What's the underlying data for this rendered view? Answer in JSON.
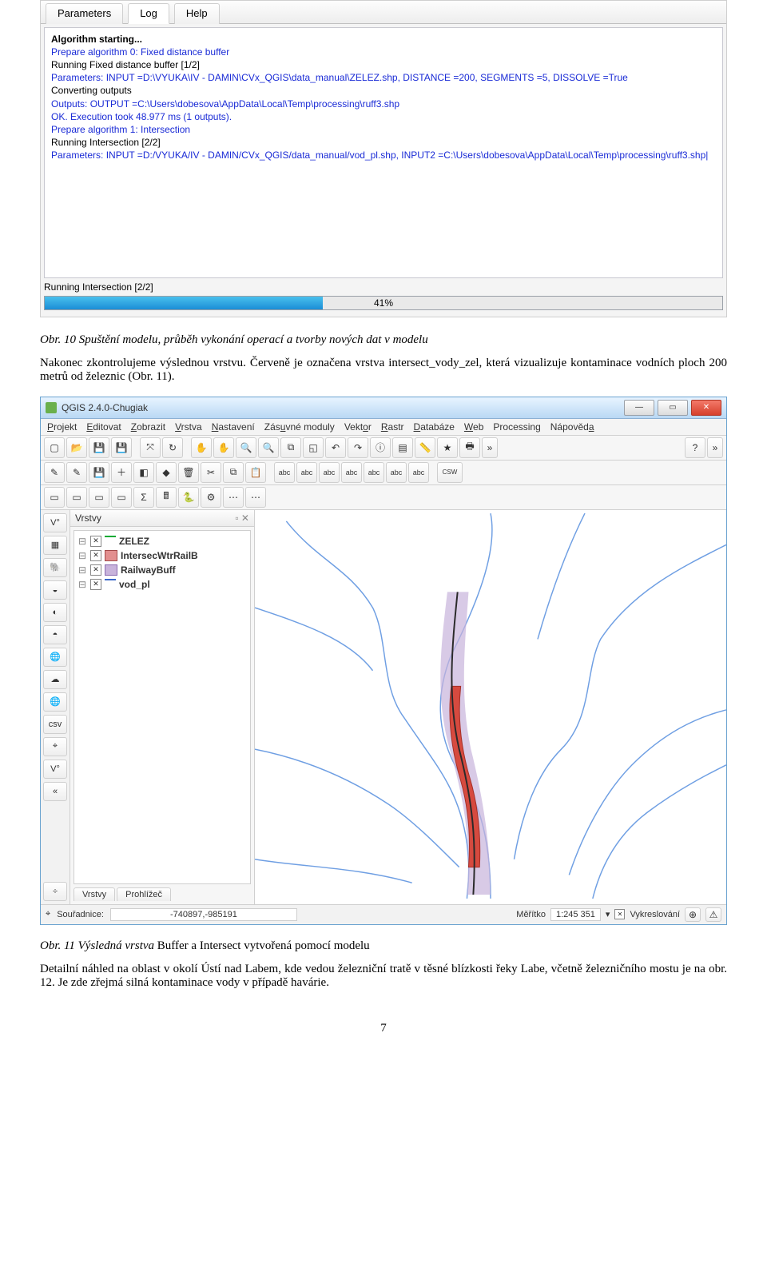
{
  "log_window": {
    "tabs": [
      "Parameters",
      "Log",
      "Help"
    ],
    "active_tab": 1,
    "lines": [
      {
        "cls": "bold",
        "text": "Algorithm starting..."
      },
      {
        "cls": "blue",
        "text": "Prepare algorithm 0: Fixed distance buffer"
      },
      {
        "cls": "black",
        "text": "Running Fixed distance buffer [1/2]"
      },
      {
        "cls": "blue",
        "text": "Parameters: INPUT =D:\\VYUKA\\IV - DAMIN\\CVx_QGIS\\data_manual\\ZELEZ.shp, DISTANCE =200, SEGMENTS =5, DISSOLVE =True"
      },
      {
        "cls": "black",
        "text": "Converting outputs"
      },
      {
        "cls": "blue",
        "text": "Outputs: OUTPUT =C:\\Users\\dobesova\\AppData\\Local\\Temp\\processing\\ruff3.shp"
      },
      {
        "cls": "blue",
        "text": "OK. Execution took 48.977 ms (1 outputs)."
      },
      {
        "cls": "blue",
        "text": "Prepare algorithm 1: Intersection"
      },
      {
        "cls": "black",
        "text": "Running Intersection [2/2]"
      },
      {
        "cls": "blue",
        "text": "Parameters: INPUT =D:/VYUKA/IV - DAMIN/CVx_QGIS/data_manual/vod_pl.shp, INPUT2 =C:\\Users\\dobesova\\AppData\\Local\\Temp\\processing\\ruff3.shp|"
      }
    ],
    "status": "Running Intersection [2/2]",
    "progress_pct": "41%"
  },
  "caption1": "Obr. 10 Spuštění modelu, průběh vykonání operací a tvorby nových dat v modelu",
  "para1": "Nakonec zkontrolujeme výslednou vrstvu. Červeně je označena vrstva intersect_vody_zel, která vizualizuje kontaminace vodních ploch 200 metrů od železnic (Obr. 11).",
  "qgis": {
    "title": "QGIS 2.4.0-Chugiak",
    "menus": [
      "Projekt",
      "Editovat",
      "Zobrazit",
      "Vrstva",
      "Nastavení",
      "Zásuvné moduly",
      "Vektor",
      "Rastr",
      "Databáze",
      "Web",
      "Processing",
      "Nápověda"
    ],
    "layers_title": "Vrstvy",
    "layers": [
      {
        "name": "ZELEZ",
        "ico": "line",
        "bold": true
      },
      {
        "name": "IntersecWtrRailB",
        "ico": "poly1",
        "bold": true
      },
      {
        "name": "RailwayBuff",
        "ico": "poly2",
        "bold": true
      },
      {
        "name": "vod_pl",
        "ico": "line2",
        "bold": true
      }
    ],
    "bottom_tabs": [
      "Vrstvy",
      "Prohlížeč"
    ],
    "status": {
      "coord_label": "Souřadnice:",
      "coord_value": "-740897,-985191",
      "scale_label": "Měřítko",
      "scale_value": "1:245 351",
      "render_label": "Vykreslování"
    }
  },
  "caption2_prefix": "Obr. 11 Výsledná vrstva ",
  "caption2_rest": "Buffer a Intersect vytvořená pomocí modelu",
  "para2": "Detailní náhled na oblast v okolí Ústí nad Labem, kde vedou železniční tratě v těsné blízkosti řeky Labe, včetně železničního mostu je na obr. 12. Je zde zřejmá silná kontaminace vody v případě havárie.",
  "page_number": "7"
}
